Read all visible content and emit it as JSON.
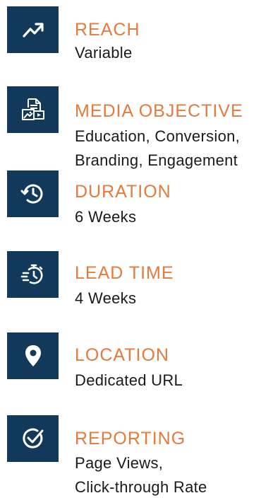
{
  "accent_color": "#e47a3c",
  "tile_color": "#12385a",
  "items": [
    {
      "icon": "trending-up-icon",
      "label": "REACH",
      "lines": [
        "Variable"
      ]
    },
    {
      "icon": "media-document-icon",
      "label": "MEDIA OBJECTIVE",
      "lines": [
        "Education, Conversion,",
        "Branding, Engagement"
      ]
    },
    {
      "icon": "history-clock-icon",
      "label": "DURATION",
      "lines": [
        "6 Weeks"
      ]
    },
    {
      "icon": "stopwatch-icon",
      "label": "LEAD TIME",
      "lines": [
        "4 Weeks"
      ]
    },
    {
      "icon": "location-pin-icon",
      "label": "LOCATION",
      "lines": [
        "Dedicated URL"
      ]
    },
    {
      "icon": "check-circle-icon",
      "label": "REPORTING",
      "lines": [
        "Page Views,",
        "Click-through Rate"
      ]
    }
  ]
}
